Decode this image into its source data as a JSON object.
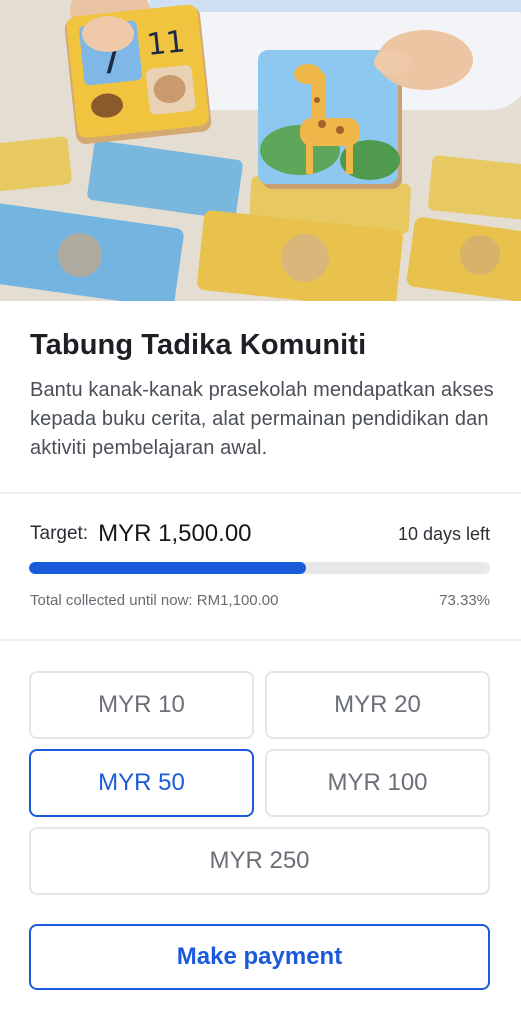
{
  "campaign": {
    "title": "Tabung Tadika Komuniti",
    "description": "Bantu kanak-kanak prasekolah mendapatkan akses kepada buku cerita, alat permainan pendidikan dan aktiviti pembelajaran awal."
  },
  "funding": {
    "target_label": "Target:",
    "target_amount": "MYR 1,500.00",
    "days_left": "10 days left",
    "collected_text": "Total collected until now: RM1,100.00",
    "percent_text": "73.33%",
    "progress_fraction": 0.6,
    "accent_color": "#1a5bdc"
  },
  "amount_options": [
    {
      "label": "MYR 10",
      "selected": false
    },
    {
      "label": "MYR 20",
      "selected": false
    },
    {
      "label": "MYR 50",
      "selected": true
    },
    {
      "label": "MYR 100",
      "selected": false
    },
    {
      "label": "MYR 250",
      "selected": false
    }
  ],
  "hero_image": {
    "description_name": "children-puzzle-photo",
    "puzzle_numbers": [
      "7",
      "11",
      "11"
    ]
  },
  "actions": {
    "pay_label": "Make payment"
  }
}
